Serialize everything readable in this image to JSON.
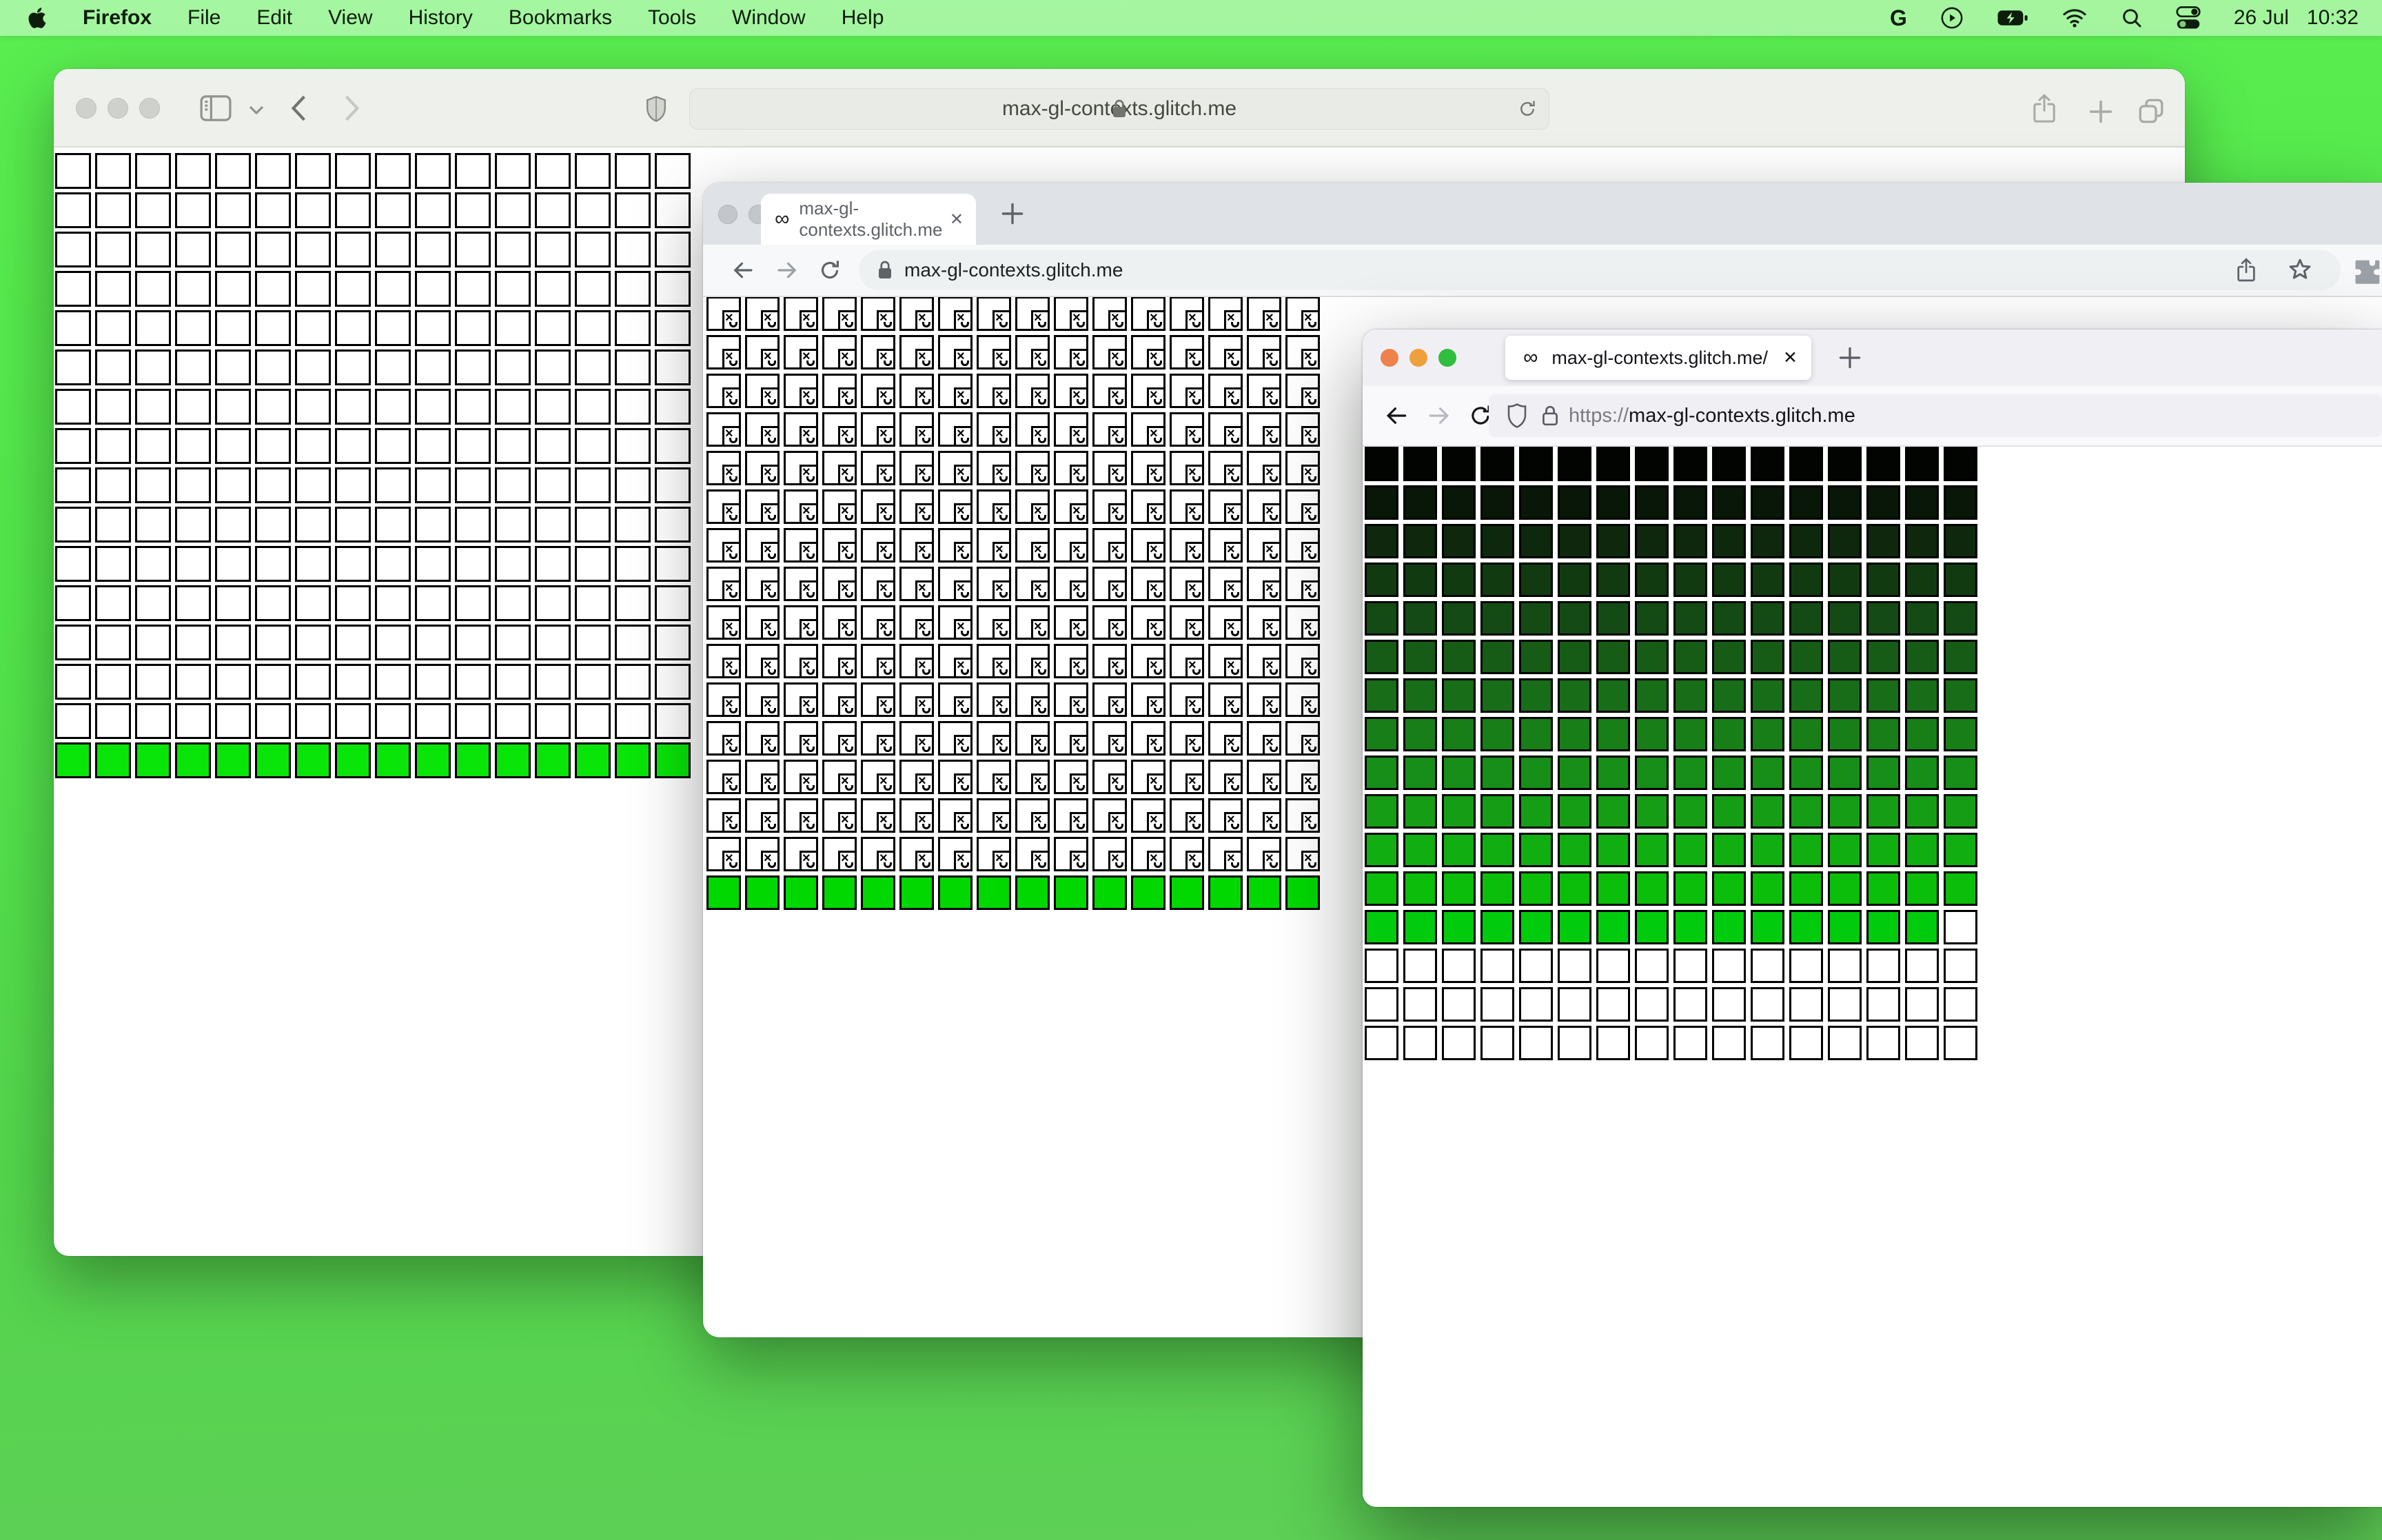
{
  "menu_bar": {
    "app_name": "Firefox",
    "menus": [
      "File",
      "Edit",
      "View",
      "History",
      "Bookmarks",
      "Tools",
      "Window",
      "Help"
    ],
    "google_label": "G",
    "date": "26 Jul",
    "time": "10:32"
  },
  "safari": {
    "url": "max-gl-contexts.glitch.me"
  },
  "chrome": {
    "favicon": "∞",
    "tab_title": "max-gl-contexts.glitch.me",
    "close_glyph": "✕",
    "url": "max-gl-contexts.glitch.me"
  },
  "firefox": {
    "favicon": "∞",
    "tab_title": "max-gl-contexts.glitch.me/",
    "close_glyph": "✕",
    "url_scheme": "https://",
    "url_domain": "max-gl-contexts.glitch.me"
  },
  "grids": {
    "safari": {
      "cols": 16,
      "rows": [
        {
          "color": "#ffffff",
          "count": 15
        },
        {
          "color": "#09e409",
          "count": 1
        }
      ]
    },
    "chrome": {
      "cols": 16,
      "rows": [
        {
          "color": "#ffffff",
          "count": 15,
          "broken": true
        },
        {
          "color": "#00d800",
          "count": 1
        }
      ]
    },
    "firefox": {
      "cols": 16,
      "rows": [
        {
          "color": "#010401",
          "count": 1
        },
        {
          "color": "#081708",
          "count": 1
        },
        {
          "color": "#0d280d",
          "count": 1
        },
        {
          "color": "#113a11",
          "count": 1
        },
        {
          "color": "#144b14",
          "count": 1
        },
        {
          "color": "#165c16",
          "count": 1
        },
        {
          "color": "#186d18",
          "count": 1
        },
        {
          "color": "#187e18",
          "count": 1
        },
        {
          "color": "#178e17",
          "count": 1
        },
        {
          "color": "#159e15",
          "count": 1
        },
        {
          "color": "#11ae11",
          "count": 1
        },
        {
          "color": "#0abe0a",
          "count": 1
        },
        {
          "color": "#00cb0c",
          "count": 1
        },
        {
          "color": "#ffffff",
          "count": 3
        }
      ],
      "overrides": [
        {
          "row": 12,
          "col": 15,
          "color": "#ffffff"
        }
      ]
    }
  }
}
